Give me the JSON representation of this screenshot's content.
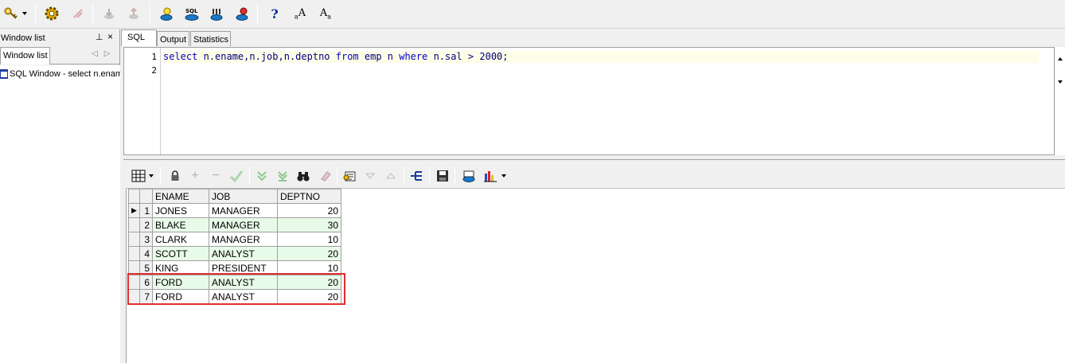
{
  "left_panel": {
    "header_title": "Window list",
    "pin_glyph": "⊥",
    "close_glyph": "×",
    "tab_label": "Window list",
    "nav_arrows": "◁▷",
    "items": [
      {
        "label": "SQL Window - select n.ename"
      }
    ]
  },
  "editor_tabs": [
    {
      "label": "SQL"
    },
    {
      "label": "Output"
    },
    {
      "label": "Statistics"
    }
  ],
  "editor": {
    "line_numbers": [
      "1",
      "2"
    ],
    "sql": {
      "kw_select": "select",
      "cols": " n.ename,n.job,n.deptno ",
      "kw_from": "from",
      "table": " emp n ",
      "kw_where": "where",
      "cond": " n.sal > 2000;"
    }
  },
  "toolbar_icons": [
    "key-icon",
    "execute-gear-icon",
    "break-icon",
    "commit-icon",
    "rollback-icon",
    "explain-plan-icon",
    "sql-icon",
    "command-window-icon",
    "report-icon",
    "help-icon",
    "font-smaller-icon",
    "font-larger-icon"
  ],
  "help_glyph": "?",
  "font_glyph": "A",
  "grid": {
    "columns": [
      "ENAME",
      "JOB",
      "DEPTNO"
    ],
    "current_row_marker": "▶",
    "rows": [
      {
        "n": "1",
        "ename": "JONES",
        "job": "MANAGER",
        "deptno": "20"
      },
      {
        "n": "2",
        "ename": "BLAKE",
        "job": "MANAGER",
        "deptno": "30"
      },
      {
        "n": "3",
        "ename": "CLARK",
        "job": "MANAGER",
        "deptno": "10"
      },
      {
        "n": "4",
        "ename": "SCOTT",
        "job": "ANALYST",
        "deptno": "20"
      },
      {
        "n": "5",
        "ename": "KING",
        "job": "PRESIDENT",
        "deptno": "10"
      },
      {
        "n": "6",
        "ename": "FORD",
        "job": "ANALYST",
        "deptno": "20"
      },
      {
        "n": "7",
        "ename": "FORD",
        "job": "ANALYST",
        "deptno": "20"
      }
    ]
  },
  "colors": {
    "highlight_box": "#e03030",
    "alt_row": "#e8fae8",
    "keyword": "#0000c8"
  }
}
